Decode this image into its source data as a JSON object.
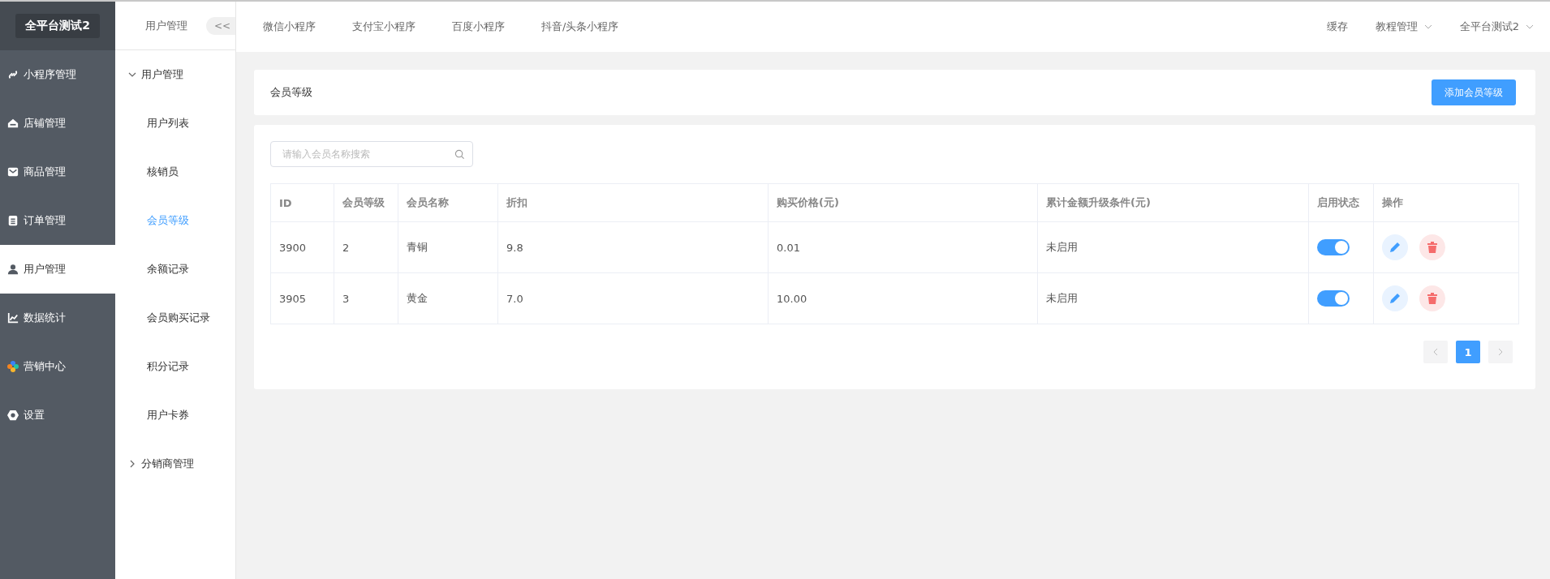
{
  "sidebar": {
    "logo": "全平台测试2",
    "items": [
      {
        "label": "小程序管理",
        "selected": false
      },
      {
        "label": "店铺管理",
        "selected": false
      },
      {
        "label": "商品管理",
        "selected": false
      },
      {
        "label": "订单管理",
        "selected": false
      },
      {
        "label": "用户管理",
        "selected": true
      },
      {
        "label": "数据统计",
        "selected": false
      },
      {
        "label": "营销中心",
        "selected": false
      },
      {
        "label": "设置",
        "selected": false
      }
    ]
  },
  "submenu": {
    "title": "用户管理",
    "collapse": "<<",
    "groups": [
      {
        "label": "用户管理",
        "expanded": true,
        "children": [
          {
            "label": "用户列表",
            "selected": false
          },
          {
            "label": "核销员",
            "selected": false
          },
          {
            "label": "会员等级",
            "selected": true
          },
          {
            "label": "余额记录",
            "selected": false
          },
          {
            "label": "会员购买记录",
            "selected": false
          },
          {
            "label": "积分记录",
            "selected": false
          },
          {
            "label": "用户卡券",
            "selected": false
          }
        ]
      },
      {
        "label": "分销商管理",
        "expanded": false
      }
    ]
  },
  "topbar": {
    "tabs": [
      "微信小程序",
      "支付宝小程序",
      "百度小程序",
      "抖音/头条小程序"
    ],
    "right": [
      {
        "label": "缓存",
        "dropdown": false
      },
      {
        "label": "教程管理",
        "dropdown": true
      },
      {
        "label": "全平台测试2",
        "dropdown": true
      }
    ]
  },
  "header": {
    "title": "会员等级",
    "button": "添加会员等级"
  },
  "search": {
    "placeholder": "请输入会员名称搜索"
  },
  "table": {
    "columns": [
      "ID",
      "会员等级",
      "会员名称",
      "折扣",
      "购买价格(元)",
      "累计金额升级条件(元)",
      "启用状态",
      "操作"
    ],
    "rows": [
      {
        "id": "3900",
        "level": "2",
        "name": "青铜",
        "discount": "9.8",
        "price": "0.01",
        "upgrade": "未启用",
        "on": true
      },
      {
        "id": "3905",
        "level": "3",
        "name": "黄金",
        "discount": "7.0",
        "price": "10.00",
        "upgrade": "未启用",
        "on": true
      }
    ]
  },
  "pagination": {
    "pages": [
      {
        "label": "1",
        "selected": true
      }
    ]
  }
}
